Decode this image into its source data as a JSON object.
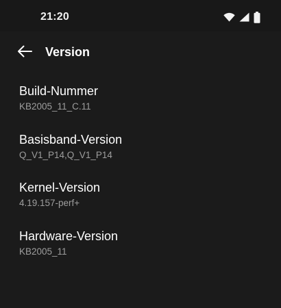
{
  "status_bar": {
    "time": "21:20",
    "icons": [
      "wifi-icon",
      "cellular-signal-icon",
      "battery-icon"
    ]
  },
  "app_bar": {
    "back_icon": "arrow-left-icon",
    "title": "Version"
  },
  "items": [
    {
      "title": "Build-Nummer",
      "value": "KB2005_11_C.11"
    },
    {
      "title": "Basisband-Version",
      "value": "Q_V1_P14,Q_V1_P14"
    },
    {
      "title": "Kernel-Version",
      "value": "4.19.157-perf+"
    },
    {
      "title": "Hardware-Version",
      "value": "KB2005_11"
    }
  ],
  "colors": {
    "background": "#1b1b1b",
    "status_bar": "#181818",
    "primary_text": "#ffffff",
    "secondary_text": "#9e9e9e"
  }
}
